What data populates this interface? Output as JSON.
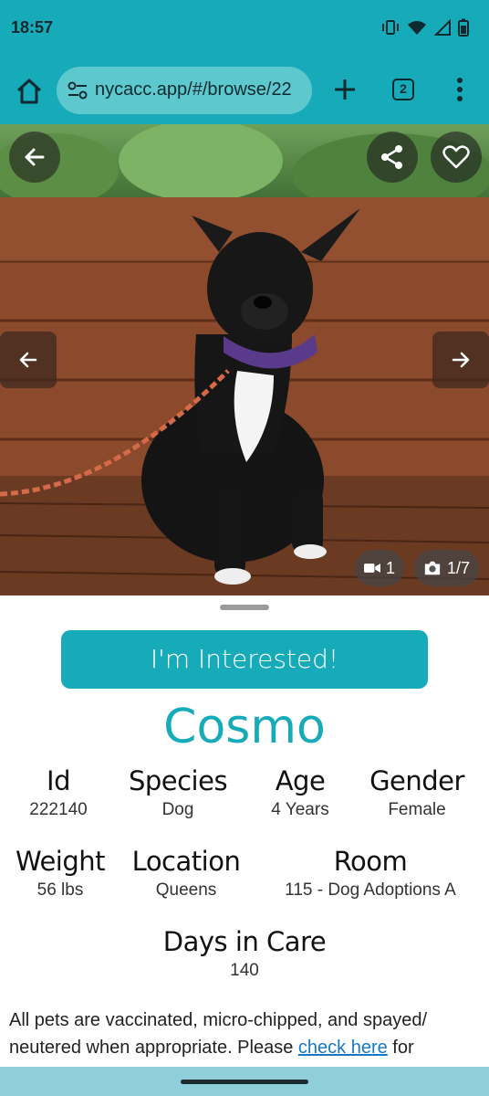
{
  "status": {
    "time": "18:57"
  },
  "browser": {
    "url": "nycacc.app/#/browse/22",
    "tab_count": "2"
  },
  "gallery": {
    "video_count": "1",
    "photo_counter": "1/7"
  },
  "actions": {
    "interested_label": "I'm Interested!"
  },
  "pet": {
    "name": "Cosmo",
    "fields": [
      {
        "label": "Id",
        "value": "222140"
      },
      {
        "label": "Species",
        "value": "Dog"
      },
      {
        "label": "Age",
        "value": "4 Years"
      },
      {
        "label": "Gender",
        "value": "Female"
      },
      {
        "label": "Weight",
        "value": "56 lbs"
      },
      {
        "label": "Location",
        "value": "Queens"
      },
      {
        "label": "Room",
        "value": "115 - Dog Adoptions A"
      },
      {
        "label": "Days in Care",
        "value": "140"
      }
    ]
  },
  "info": {
    "text_before": "All pets are vaccinated, micro-chipped, and spayed/ neutered when appropriate. Please ",
    "link": "check here",
    "text_after": " for"
  },
  "colors": {
    "accent": "#17aab8"
  }
}
